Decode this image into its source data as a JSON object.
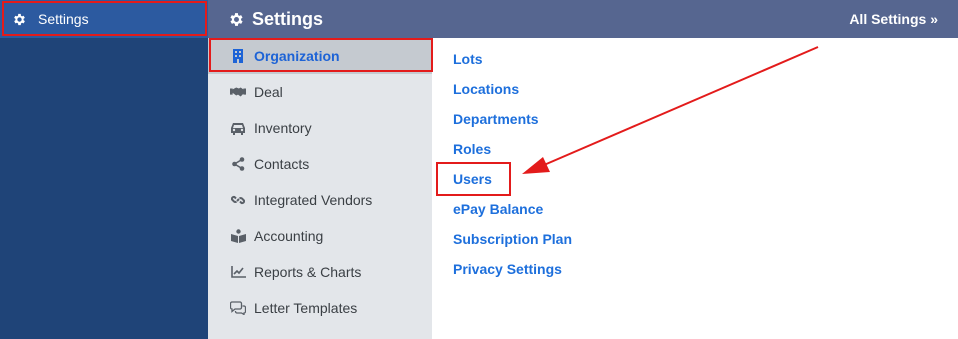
{
  "sidebar": {
    "settings_label": "Settings",
    "settings_icon": "gear-icon"
  },
  "header": {
    "title": "Settings",
    "title_icon": "gear-icon",
    "all_settings": "All Settings »"
  },
  "categories": [
    {
      "label": "Organization",
      "icon": "building-icon",
      "active": true
    },
    {
      "label": "Deal",
      "icon": "handshake-icon"
    },
    {
      "label": "Inventory",
      "icon": "car-icon"
    },
    {
      "label": "Contacts",
      "icon": "share-icon"
    },
    {
      "label": "Integrated Vendors",
      "icon": "link-icon"
    },
    {
      "label": "Accounting",
      "icon": "book-icon"
    },
    {
      "label": "Reports & Charts",
      "icon": "chart-line-icon"
    },
    {
      "label": "Letter Templates",
      "icon": "comments-icon"
    }
  ],
  "links": [
    {
      "label": "Lots"
    },
    {
      "label": "Locations"
    },
    {
      "label": "Departments"
    },
    {
      "label": "Roles"
    },
    {
      "label": "Users",
      "highlighted": true
    },
    {
      "label": "ePay Balance"
    },
    {
      "label": "Subscription Plan"
    },
    {
      "label": "Privacy Settings"
    }
  ],
  "colors": {
    "sidebar_bg": "#1f4478",
    "sidebar_active": "#2c5aa0",
    "header_bg": "#566690",
    "menu_bg": "#e3e6ea",
    "menu_active": "#c5cad0",
    "link": "#1d6fdc",
    "annotation": "#e31b1b"
  }
}
